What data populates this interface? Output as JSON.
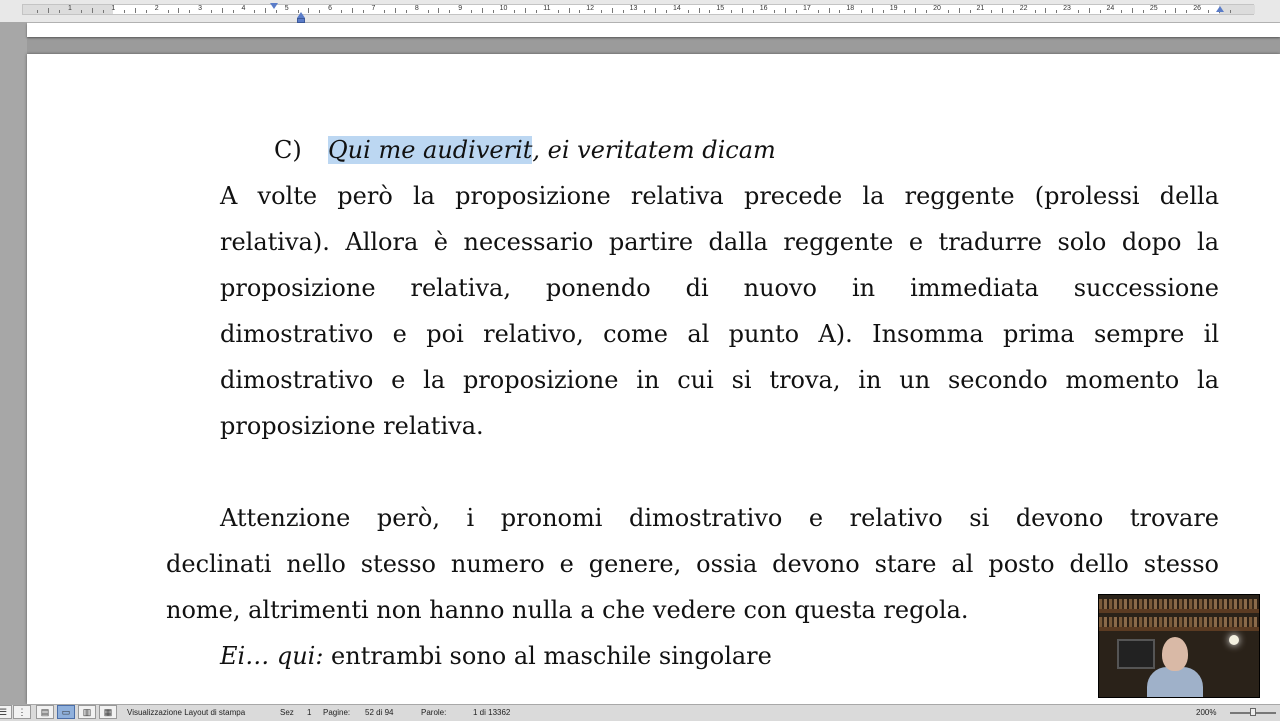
{
  "ruler": {
    "numbers": [
      "1",
      "1",
      "2",
      "3",
      "4",
      "5",
      "6",
      "7",
      "8",
      "9",
      "10",
      "11",
      "12",
      "13",
      "14",
      "15",
      "16",
      "17",
      "18",
      "19",
      "20",
      "21",
      "22",
      "23",
      "24",
      "25",
      "26"
    ]
  },
  "document": {
    "item_c": {
      "marker": "C)",
      "selected_text": "Qui me audiverit",
      "rest_text": ", ei veritatem dicam"
    },
    "paragraph1_lines": [
      "A volte però la proposizione relativa precede la reggente (prolessi della",
      "relativa). Allora è necessario partire dalla reggente e tradurre solo dopo la",
      "proposizione relativa, ponendo di nuovo in immediata successione",
      "dimostrativo e poi relativo, come al punto A). Insomma prima sempre il",
      "dimostrativo e la proposizione in cui si trova, in un secondo momento la",
      "proposizione relativa."
    ],
    "paragraph2_lines": [
      "Attenzione però, i pronomi dimostrativo e relativo si devono trovare",
      "declinati nello stesso numero e genere,  ossia devono stare al posto dello stesso",
      "nome, altrimenti non hanno nulla a che vedere con questa regola."
    ],
    "example": {
      "italic": "Ei… qui:",
      "normal": " entrambi sono al maschile singolare"
    }
  },
  "statusbar": {
    "view_icons": [
      "draft-view-icon",
      "outline-view-icon",
      "publishing-layout-icon",
      "print-layout-icon",
      "notebook-view-icon",
      "focus-view-icon"
    ],
    "view_label": "Visualizzazione Layout di stampa",
    "section_label": "Sez",
    "section_value": "1",
    "pages_label": "Pagine:",
    "pages_value": "52 di 94",
    "words_label": "Parole:",
    "words_value": "1 di 13362",
    "zoom": "200%"
  },
  "colors": {
    "selection": "#bcd7f2",
    "active_view": "#8fb0dc"
  }
}
